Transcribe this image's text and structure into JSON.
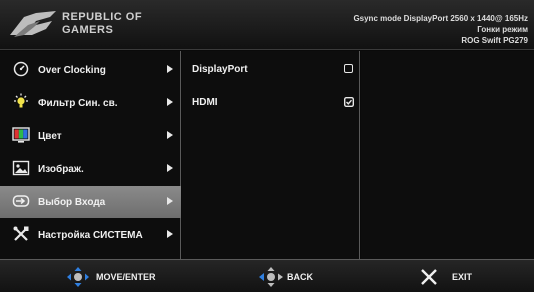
{
  "header": {
    "brand_line1": "REPUBLIC OF",
    "brand_line2": "GAMERS",
    "status_line1": "Gsync mode DisplayPort 2560 x 1440@ 165Hz",
    "status_line2": "Гонки режим",
    "status_line3": "ROG Swift PG279"
  },
  "menu": {
    "items": [
      {
        "label": "Over Clocking",
        "icon": "speedometer-icon"
      },
      {
        "label": "Фильтр Син. св.",
        "icon": "light-bulb-icon"
      },
      {
        "label": "Цвет",
        "icon": "color-icon"
      },
      {
        "label": "Изображ.",
        "icon": "image-icon"
      },
      {
        "label": "Выбор Входа",
        "icon": "input-select-icon",
        "selected": true
      },
      {
        "label": "Настройка СИСТЕМА",
        "icon": "tools-icon"
      }
    ]
  },
  "inputs": {
    "items": [
      {
        "label": "DisplayPort",
        "checked": false
      },
      {
        "label": "HDMI",
        "checked": true
      }
    ]
  },
  "footer": {
    "move_label": "MOVE/ENTER",
    "back_label": "BACK",
    "exit_label": "EXIT"
  },
  "colors": {
    "selected_bg": "#7c7c7c",
    "accent_blue": "#2f7fe0"
  }
}
